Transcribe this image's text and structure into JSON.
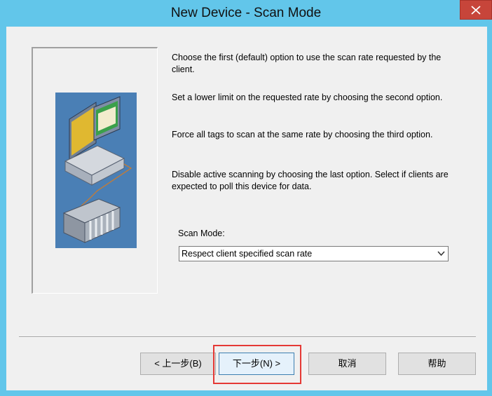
{
  "window": {
    "title": "New Device - Scan Mode"
  },
  "descriptions": [
    "Choose the first (default) option to use the scan rate requested by the client.",
    "Set a lower limit on the requested rate by choosing the second option.",
    "Force all tags to scan at the same rate by choosing the third option.",
    "Disable active scanning by choosing the last option. Select if clients are expected to poll this device for data."
  ],
  "scan_mode": {
    "label": "Scan Mode:",
    "value": "Respect client specified scan rate"
  },
  "buttons": {
    "back": "< 上一步(B)",
    "next": "下一步(N) >",
    "cancel": "取消",
    "help": "帮助"
  },
  "colors": {
    "title_bar": "#62c6ea",
    "close_button": "#c7453a",
    "dialog_bg": "#f0f0f0",
    "highlight": "#e53935"
  }
}
